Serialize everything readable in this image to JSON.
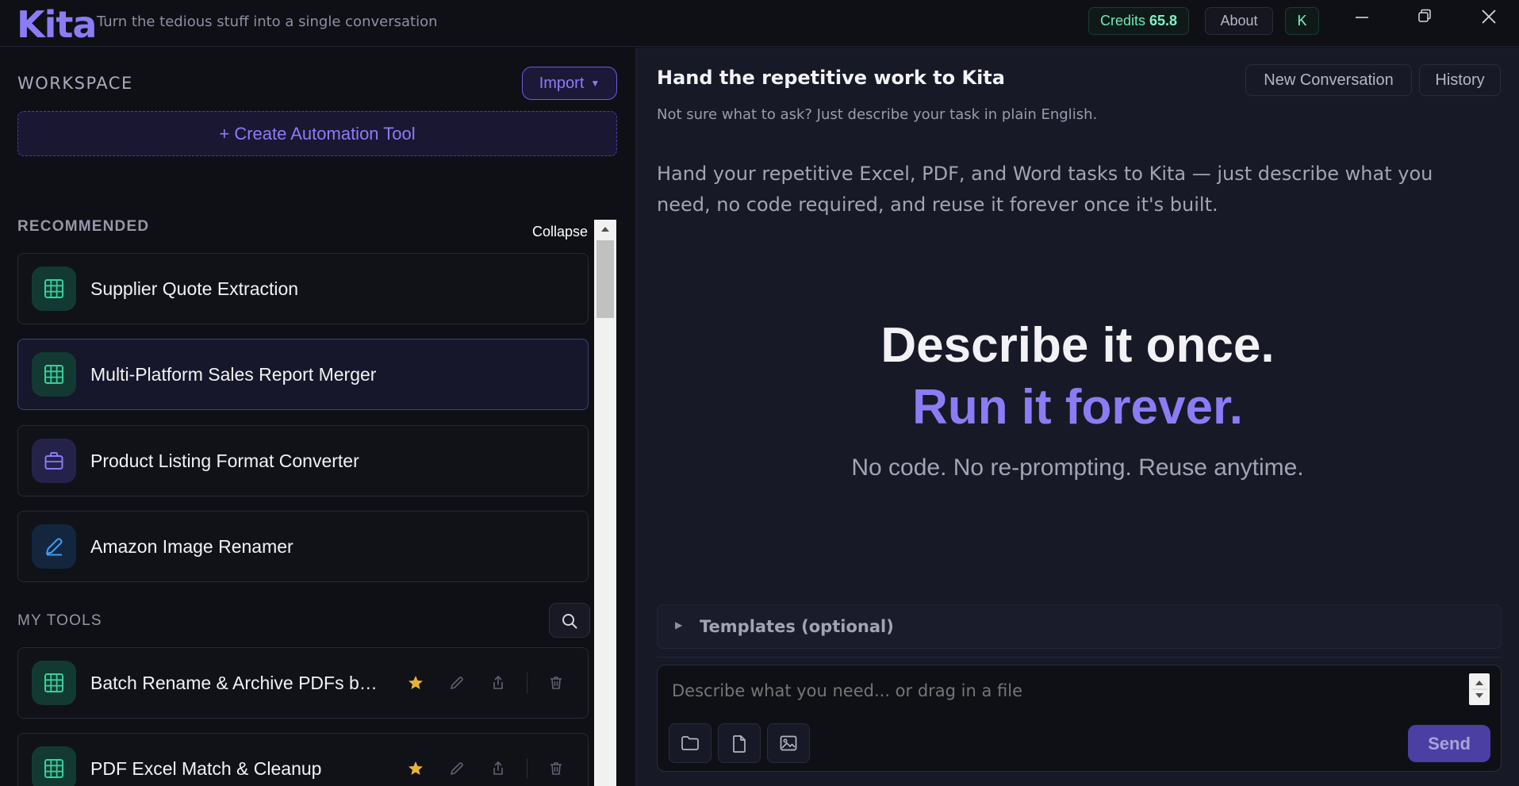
{
  "titlebar": {
    "logo": "Kita",
    "tagline": "Turn the tedious stuff into a single conversation",
    "credits_label": "Credits",
    "credits_value": "65.8",
    "about_label": "About",
    "avatar_initial": "K"
  },
  "sidebar": {
    "workspace_title": "WORKSPACE",
    "import_label": "Import",
    "create_label": "+ Create Automation Tool",
    "recommended_title": "RECOMMENDED",
    "collapse_label": "Collapse",
    "recommended": [
      {
        "name": "Supplier Quote Extraction",
        "icon": "spreadsheet-icon"
      },
      {
        "name": "Multi-Platform Sales Report Merger",
        "icon": "spreadsheet-icon"
      },
      {
        "name": "Product Listing Format Converter",
        "icon": "briefcase-icon"
      },
      {
        "name": "Amazon Image Renamer",
        "icon": "pencil-icon"
      }
    ],
    "my_tools_title": "MY TOOLS",
    "my_tools": [
      {
        "name": "Batch Rename & Archive PDFs by Invoice",
        "icon": "spreadsheet-icon"
      },
      {
        "name": "PDF Excel Match & Cleanup",
        "icon": "spreadsheet-icon"
      }
    ]
  },
  "main": {
    "title": "Hand the repetitive work to Kita",
    "subtitle": "Not sure what to ask? Just describe your task in plain English.",
    "new_conversation_label": "New Conversation",
    "history_label": "History",
    "intro": "Hand your repetitive Excel, PDF, and Word tasks to Kita — just describe what you need, no code required, and reuse it forever once it's built.",
    "hero_line1": "Describe it once.",
    "hero_line2": "Run it forever.",
    "hero_line3": "No code. No re-prompting. Reuse anytime.",
    "templates_label": "Templates (optional)",
    "composer_placeholder": "Describe what you need... or drag in a file",
    "send_label": "Send"
  },
  "colors": {
    "accent": "#8b7cf6",
    "credits_green": "#6ee7b7",
    "star": "#e8b33a",
    "background": "#0f1016",
    "panel": "#181926"
  }
}
